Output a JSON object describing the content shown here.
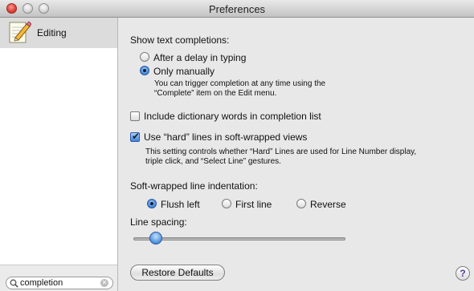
{
  "window": {
    "title": "Preferences"
  },
  "sidebar": {
    "items": [
      {
        "label": "Editing",
        "icon": "pencil-document-icon"
      }
    ],
    "search": {
      "value": "completion"
    }
  },
  "completions": {
    "heading": "Show text completions:",
    "options": [
      {
        "label": "After a delay in typing",
        "selected": false
      },
      {
        "label": "Only manually",
        "selected": true
      }
    ],
    "note_line1": "You can trigger completion at any time using the",
    "note_line2": "“Complete” item on the Edit menu."
  },
  "dictionary_checkbox": {
    "label": "Include dictionary words in completion list",
    "checked": false
  },
  "hard_lines_checkbox": {
    "label": "Use “hard” lines in soft-wrapped views",
    "checked": true,
    "note_line1": "This setting controls whether “Hard” Lines are used for Line Number display,",
    "note_line2": "triple click, and “Select Line” gestures."
  },
  "indentation": {
    "heading": "Soft-wrapped line indentation:",
    "options": [
      {
        "label": "Flush left",
        "selected": true
      },
      {
        "label": "First line",
        "selected": false
      },
      {
        "label": "Reverse",
        "selected": false
      }
    ]
  },
  "line_spacing": {
    "label": "Line spacing:",
    "value_fraction": 0.08
  },
  "buttons": {
    "restore_defaults": "Restore Defaults",
    "help": "?"
  },
  "colors": {
    "accent": "#3f85d6",
    "sidebar_selected": "#dcdcdc",
    "window_bg": "#e8e8e8"
  }
}
